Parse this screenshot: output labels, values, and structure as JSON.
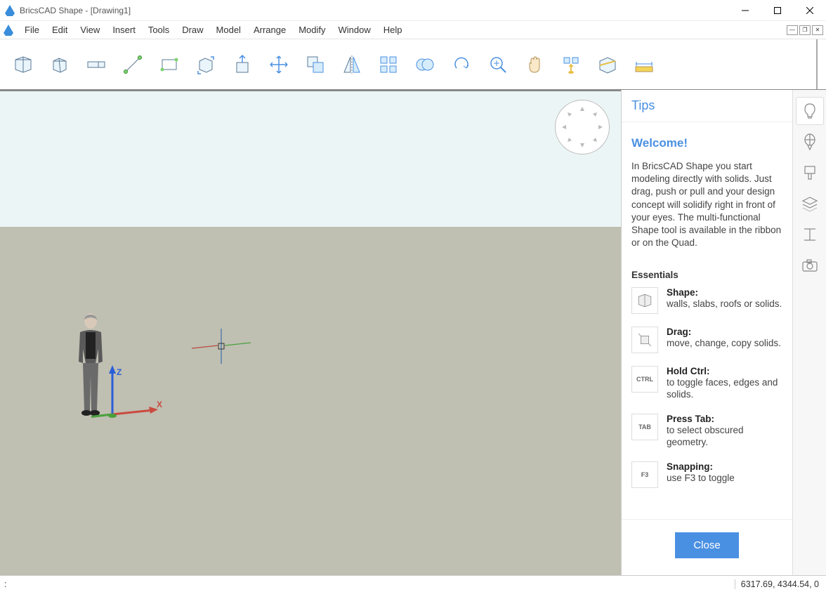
{
  "titlebar": {
    "title": "BricsCAD Shape - [Drawing1]"
  },
  "menu": [
    "File",
    "Edit",
    "View",
    "Insert",
    "Tools",
    "Draw",
    "Model",
    "Arrange",
    "Modify",
    "Window",
    "Help"
  ],
  "toolbar": [
    "shape",
    "box",
    "wall",
    "line",
    "rectangle",
    "drag",
    "pushpull",
    "move",
    "copy",
    "mirror",
    "array",
    "union",
    "rotate",
    "zoom",
    "pan",
    "visual-style",
    "section",
    "measure-ruler"
  ],
  "tips": {
    "header": "Tips",
    "welcome": "Welcome!",
    "intro": "In BricsCAD Shape you start modeling directly with solids. Just drag, push or pull and your design concept will solidify right in front of your eyes. The multi-functional Shape tool is available in the ribbon or on the Quad.",
    "essentials_heading": "Essentials",
    "essentials": [
      {
        "icon": "shape",
        "title": "Shape:",
        "desc": "walls, slabs, roofs or solids."
      },
      {
        "icon": "drag",
        "title": "Drag:",
        "desc": "move, change, copy solids."
      },
      {
        "icon": "CTRL",
        "title": "Hold Ctrl:",
        "desc": "to toggle faces, edges and solids."
      },
      {
        "icon": "TAB",
        "title": "Press Tab:",
        "desc": "to select obscured geometry."
      },
      {
        "icon": "F3",
        "title": "Snapping:",
        "desc": "use F3 to toggle"
      }
    ],
    "close": "Close"
  },
  "status": {
    "left": ":",
    "coords": "6317.69, 4344.54, 0"
  },
  "axis_labels": {
    "z": "Z",
    "x": "X"
  }
}
